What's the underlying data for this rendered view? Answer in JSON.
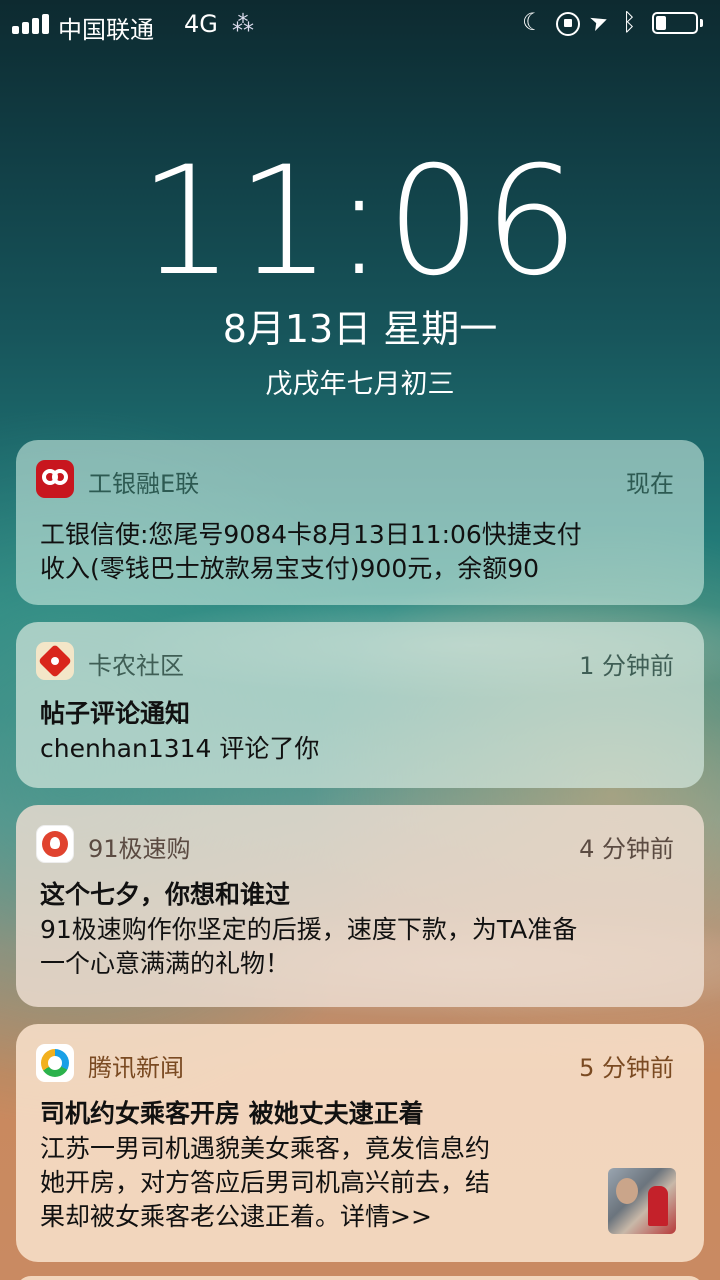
{
  "status_bar": {
    "carrier": "中国联通",
    "network": "4G",
    "loading_glyph": "⁂"
  },
  "lock_screen": {
    "time": "11:06",
    "date": "8月13日 星期一",
    "lunar_date": "戊戌年七月初三"
  },
  "notifications": [
    {
      "app": "工银融E联",
      "time": "现在",
      "icon": "icbc-icon",
      "title": "",
      "lines": [
        "工银信使:您尾号9084卡8月13日11:06快捷支付",
        "收入(零钱巴士放款易宝支付)900元，余额90"
      ]
    },
    {
      "app": "卡农社区",
      "time": "1 分钟前",
      "icon": "kanong-icon",
      "title": "帖子评论通知",
      "lines": [
        "chenhan1314 评论了你"
      ]
    },
    {
      "app": "91极速购",
      "time": "4 分钟前",
      "icon": "jisu-icon",
      "title": "这个七夕，你想和谁过",
      "lines": [
        "91极速购作你坚定的后援，速度下款，为TA准备",
        "一个心意满满的礼物！"
      ]
    },
    {
      "app": "腾讯新闻",
      "time": "5 分钟前",
      "icon": "tencent-icon",
      "title": "司机约女乘客开房 被她丈夫逮正着",
      "lines": [
        "江苏一男司机遇貌美女乘客，竟发信息约",
        "她开房，对方答应后男司机高兴前去，结",
        "果却被女乘客老公逮正着。详情>>"
      ]
    }
  ]
}
